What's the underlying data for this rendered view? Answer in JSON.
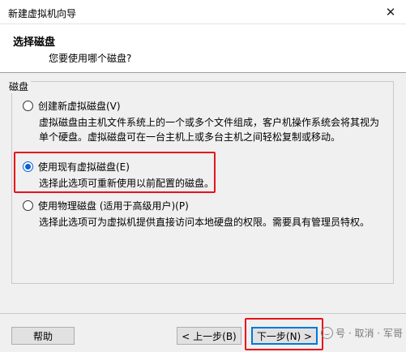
{
  "window": {
    "title": "新建虚拟机向导"
  },
  "header": {
    "title": "选择磁盘",
    "subtitle": "您要使用哪个磁盘?"
  },
  "group": {
    "label": "磁盘"
  },
  "options": [
    {
      "label": "创建新虚拟磁盘(V)",
      "desc_lines": [
        "虚拟磁盘由主机文件系统上的一个或多个文件组成，客户机操作系统会将其视为",
        "单个硬盘。虚拟磁盘可在一台主机上或多台主机之间轻松复制或移动。"
      ],
      "checked": false
    },
    {
      "label": "使用现有虚拟磁盘(E)",
      "desc_lines": [
        "选择此选项可重新使用以前配置的磁盘。"
      ],
      "checked": true
    },
    {
      "label": "使用物理磁盘 (适用于高级用户)(P)",
      "desc_lines": [
        "选择此选项可为虚拟机提供直接访问本地硬盘的权限。需要具有管理员特权。"
      ],
      "checked": false
    }
  ],
  "buttons": {
    "help": "帮助",
    "back": "< 上一步(B)",
    "next": "下一步(N) >",
    "cancel": "取消"
  },
  "watermark": {
    "text": "号 · 取消 · 军哥"
  },
  "colors": {
    "highlight": "#e8131b",
    "radio_checked": "#0a5fd6"
  }
}
